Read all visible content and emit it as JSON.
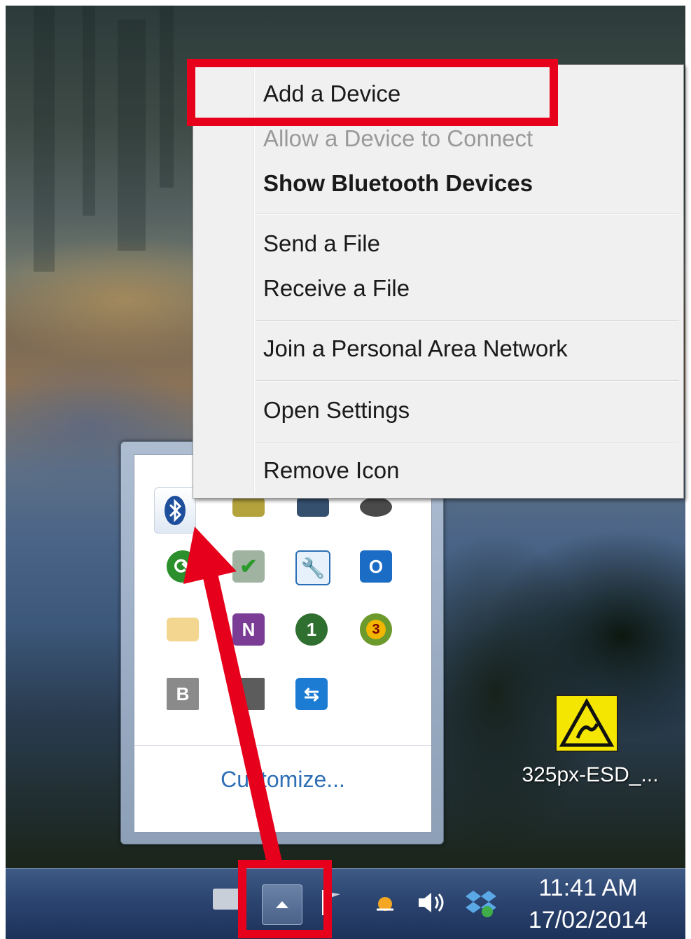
{
  "context_menu": {
    "items": [
      {
        "label": "Add a Device",
        "style": "normal"
      },
      {
        "label": "Allow a Device to Connect",
        "style": "disabled"
      },
      {
        "label": "Show Bluetooth Devices",
        "style": "bold"
      },
      {
        "label": "Send a File",
        "style": "normal"
      },
      {
        "label": "Receive a File",
        "style": "normal"
      },
      {
        "label": "Join a Personal Area Network",
        "style": "normal"
      },
      {
        "label": "Open Settings",
        "style": "normal"
      },
      {
        "label": "Remove Icon",
        "style": "normal"
      }
    ]
  },
  "tray_popup": {
    "customize_label": "Customize...",
    "icons": [
      {
        "name": "bluetooth-icon"
      },
      {
        "name": "green-network-icon"
      },
      {
        "name": "monitor-icon"
      },
      {
        "name": "people-icon"
      },
      {
        "name": "green-refresh-icon"
      },
      {
        "name": "printer-check-icon"
      },
      {
        "name": "wrench-icon"
      },
      {
        "name": "outlook-icon",
        "text": "O"
      },
      {
        "name": "mail-envelope-icon"
      },
      {
        "name": "onenote-icon",
        "text": "N"
      },
      {
        "name": "info-one-icon",
        "text": "1"
      },
      {
        "name": "badge-three-icon",
        "text": "3"
      },
      {
        "name": "b-letter-icon",
        "text": "B"
      },
      {
        "name": "devices-icon"
      },
      {
        "name": "teamviewer-icon"
      }
    ]
  },
  "desktop": {
    "shortcut_label": "325px-ESD_..."
  },
  "taskbar": {
    "time": "11:41 AM",
    "date": "17/02/2014"
  },
  "colors": {
    "highlight": "#e6001b",
    "menu_bg": "#f0f0f0",
    "taskbar": "#2b4470"
  }
}
